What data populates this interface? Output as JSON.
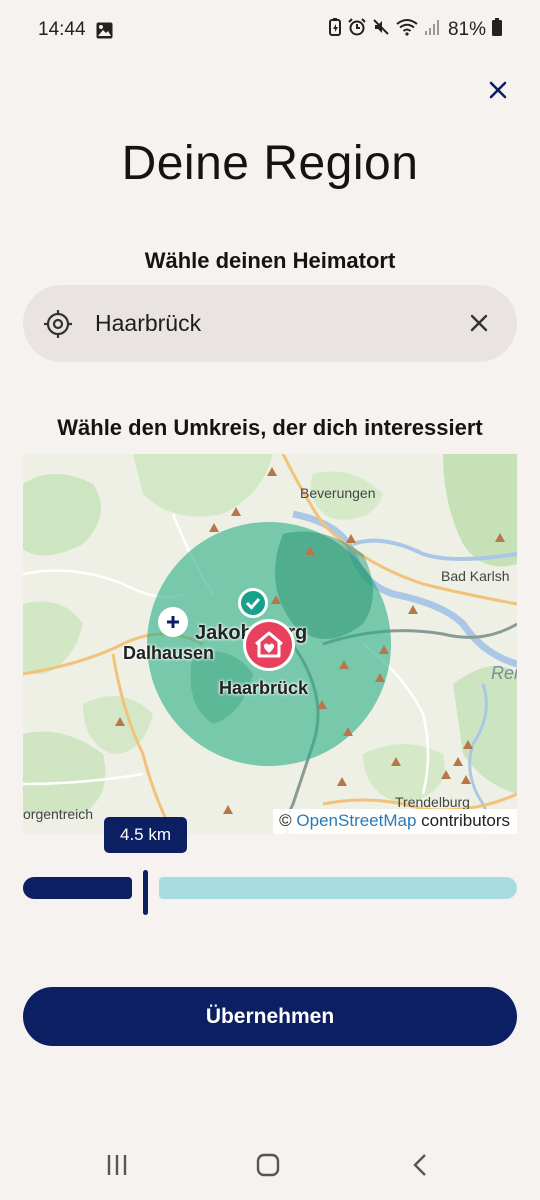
{
  "status": {
    "time": "14:44",
    "battery": "81%"
  },
  "page": {
    "title": "Deine Region",
    "hometown_label": "Wähle deinen Heimatort",
    "radius_label": "Wähle den Umkreis, der dich interessiert"
  },
  "search": {
    "value": "Haarbrück"
  },
  "map": {
    "places": [
      "Beverungen",
      "Bad Karlsh",
      "Jakobsberg",
      "Dalhausen",
      "Haarbrück",
      "Rei",
      "Trendelburg",
      "orgentreich"
    ],
    "attribution_prefix": "©",
    "attribution_link": "OpenStreetMap",
    "attribution_suffix": "contributors"
  },
  "slider": {
    "label": "4.5 km",
    "fraction": 0.25
  },
  "buttons": {
    "apply": "Übernehmen"
  },
  "colors": {
    "primary": "#0c1f62",
    "track_inactive": "#a7dde0",
    "home_pin": "#e8415f",
    "check_pin": "#17a08a",
    "radius_circle": "#2fb088"
  }
}
